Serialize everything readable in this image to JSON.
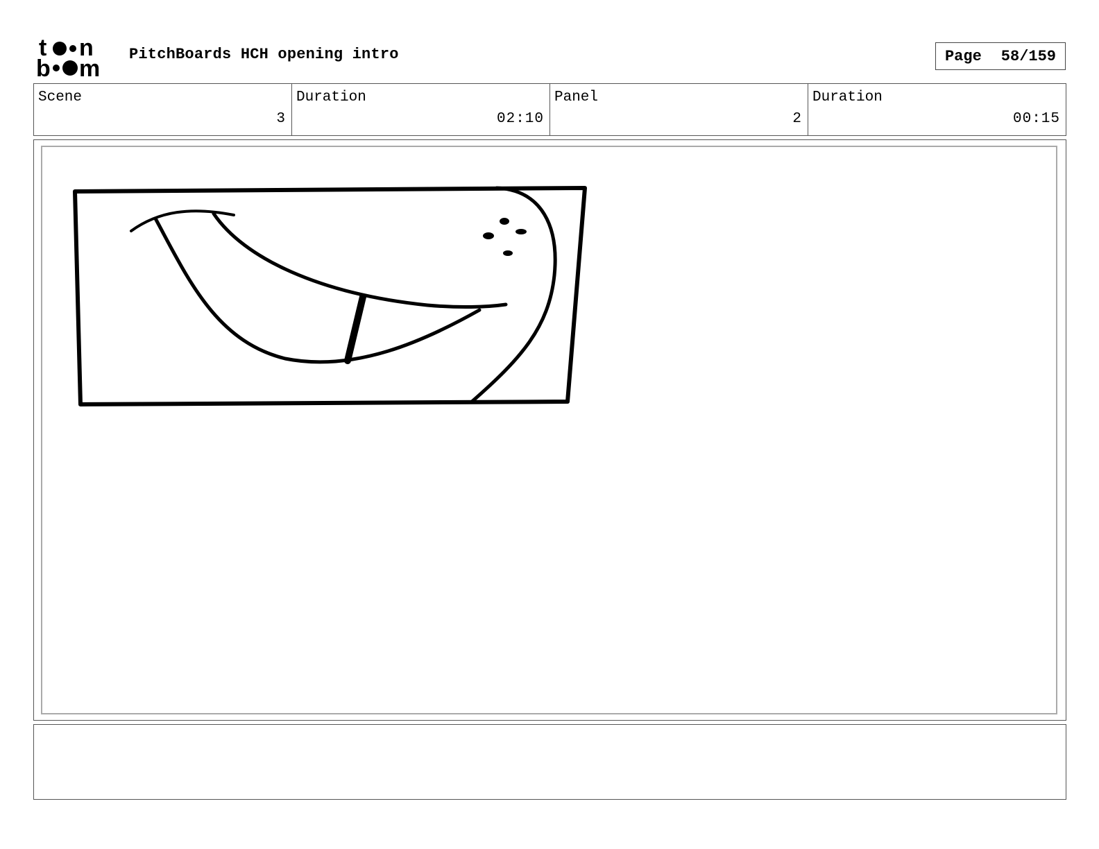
{
  "header": {
    "logo_text": "toon boom",
    "document_title": "PitchBoards HCH opening intro",
    "page_label": "Page",
    "page_value": "58/159"
  },
  "info_table": [
    {
      "label": "Scene",
      "value": "3"
    },
    {
      "label": "Duration",
      "value": "02:10"
    },
    {
      "label": "Panel",
      "value": "2"
    },
    {
      "label": "Duration",
      "value": "00:15"
    }
  ],
  "notes": {
    "text": ""
  }
}
